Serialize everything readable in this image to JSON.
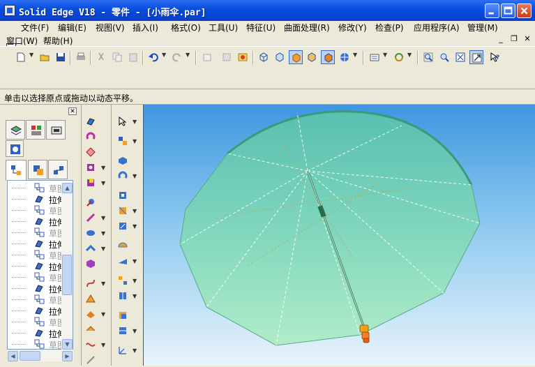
{
  "window": {
    "title": "Solid Edge V18 - 零件 - [小雨伞.par]"
  },
  "menus": [
    {
      "label": "文件(F)"
    },
    {
      "label": "编辑(E)"
    },
    {
      "label": "视图(V)"
    },
    {
      "label": "插入(I)"
    },
    {
      "label": "格式(O)"
    },
    {
      "label": "工具(U)"
    },
    {
      "label": "特征(U)"
    },
    {
      "label": "曲面处理(R)"
    },
    {
      "label": "修改(Y)"
    },
    {
      "label": "检查(P)"
    },
    {
      "label": "应用程序(A)"
    },
    {
      "label": "管理(M)"
    },
    {
      "label": "窗口(W)"
    },
    {
      "label": "帮助(H)"
    }
  ],
  "status": {
    "prompt": "单击以选择原点或拖动以动态平移。"
  },
  "feature_tree": {
    "items": [
      {
        "label": "草图",
        "kind": "sketch"
      },
      {
        "label": "拉伸",
        "kind": "protrusion"
      },
      {
        "label": "草图",
        "kind": "sketch"
      },
      {
        "label": "拉伸",
        "kind": "protrusion"
      },
      {
        "label": "草图",
        "kind": "sketch"
      },
      {
        "label": "拉伸",
        "kind": "protrusion"
      },
      {
        "label": "草图",
        "kind": "sketch"
      },
      {
        "label": "拉伸",
        "kind": "protrusion"
      },
      {
        "label": "草图",
        "kind": "sketch"
      },
      {
        "label": "拉伸",
        "kind": "protrusion"
      },
      {
        "label": "草图",
        "kind": "sketch"
      },
      {
        "label": "拉伸",
        "kind": "protrusion"
      },
      {
        "label": "草图",
        "kind": "sketch"
      },
      {
        "label": "拉伸",
        "kind": "protrusion"
      },
      {
        "label": "草图",
        "kind": "sketch"
      },
      {
        "label": "拉伸",
        "kind": "protrusion"
      }
    ]
  },
  "colors": {
    "canopy": "#7dd8b4",
    "viewport_top": "#3e96e0",
    "viewport_bottom": "#e8f4fb",
    "handle": "#f0a020"
  }
}
